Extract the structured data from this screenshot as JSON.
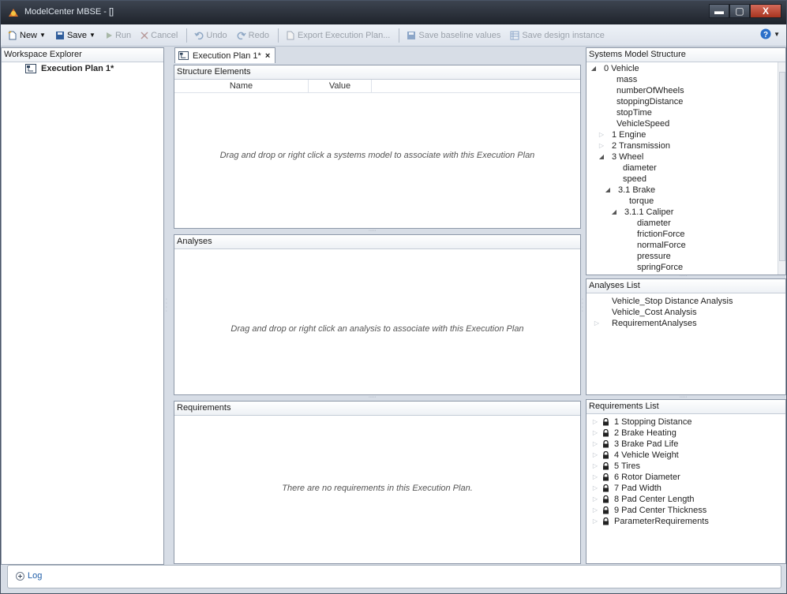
{
  "window": {
    "title": "ModelCenter MBSE - []",
    "controls": {
      "minimize": "▬",
      "maximize": "▢",
      "close": "X"
    }
  },
  "toolbar": {
    "new_label": "New",
    "save_label": "Save",
    "run_label": "Run",
    "cancel_label": "Cancel",
    "undo_label": "Undo",
    "redo_label": "Redo",
    "export_label": "Export Execution Plan...",
    "save_baseline_label": "Save baseline values",
    "save_design_label": "Save design instance"
  },
  "workspace": {
    "header": "Workspace Explorer",
    "item": "Execution Plan 1*"
  },
  "editor": {
    "tab_label": "Execution Plan 1*",
    "tab_close": "×",
    "structure": {
      "header": "Structure Elements",
      "columns": [
        "Name",
        "Value"
      ],
      "placeholder": "Drag and drop or right click a systems model to associate with this Execution Plan"
    },
    "analyses": {
      "header": "Analyses",
      "placeholder": "Drag and drop or right click an analysis to associate with this Execution Plan"
    },
    "requirements": {
      "header": "Requirements",
      "placeholder": "There are no requirements in this Execution Plan."
    }
  },
  "systems_model": {
    "header": "Systems Model Structure",
    "tree": [
      {
        "label": "0 Vehicle",
        "level": 0,
        "twisty": "open"
      },
      {
        "label": "mass",
        "level": 1,
        "twisty": ""
      },
      {
        "label": "numberOfWheels",
        "level": 1,
        "twisty": ""
      },
      {
        "label": "stoppingDistance",
        "level": 1,
        "twisty": ""
      },
      {
        "label": "stopTime",
        "level": 1,
        "twisty": ""
      },
      {
        "label": "VehicleSpeed",
        "level": 1,
        "twisty": ""
      },
      {
        "label": "1 Engine",
        "level": 1,
        "twisty": "closed"
      },
      {
        "label": "2 Transmission",
        "level": 1,
        "twisty": "closed"
      },
      {
        "label": "3 Wheel",
        "level": 1,
        "twisty": "open"
      },
      {
        "label": "diameter",
        "level": 2,
        "twisty": ""
      },
      {
        "label": "speed",
        "level": 2,
        "twisty": ""
      },
      {
        "label": "3.1 Brake",
        "level": 2,
        "twisty": "open"
      },
      {
        "label": "torque",
        "level": 3,
        "twisty": ""
      },
      {
        "label": "3.1.1 Caliper",
        "level": 3,
        "twisty": "open"
      },
      {
        "label": "diameter",
        "level": 4,
        "twisty": ""
      },
      {
        "label": "frictionForce",
        "level": 4,
        "twisty": ""
      },
      {
        "label": "normalForce",
        "level": 4,
        "twisty": ""
      },
      {
        "label": "pressure",
        "level": 4,
        "twisty": ""
      },
      {
        "label": "springForce",
        "level": 4,
        "twisty": ""
      }
    ]
  },
  "analyses_list": {
    "header": "Analyses List",
    "items": [
      {
        "label": "Vehicle_Stop Distance Analysis",
        "twisty": ""
      },
      {
        "label": "Vehicle_Cost Analysis",
        "twisty": ""
      },
      {
        "label": "RequirementAnalyses",
        "twisty": "closed"
      }
    ]
  },
  "requirements_list": {
    "header": "Requirements List",
    "items": [
      "1 Stopping Distance",
      "2 Brake Heating",
      "3 Brake Pad Life",
      "4 Vehicle Weight",
      "5 Tires",
      "6 Rotor Diameter",
      "7 Pad Width",
      "8 Pad Center Length",
      "9 Pad Center Thickness",
      "ParameterRequirements"
    ]
  },
  "log": {
    "label": "Log"
  },
  "colors": {
    "titlebar": "#2b313b",
    "accent_blue": "#1f5ea8",
    "panel_border": "#8d98a8",
    "frame_bg": "#d7dde6"
  }
}
